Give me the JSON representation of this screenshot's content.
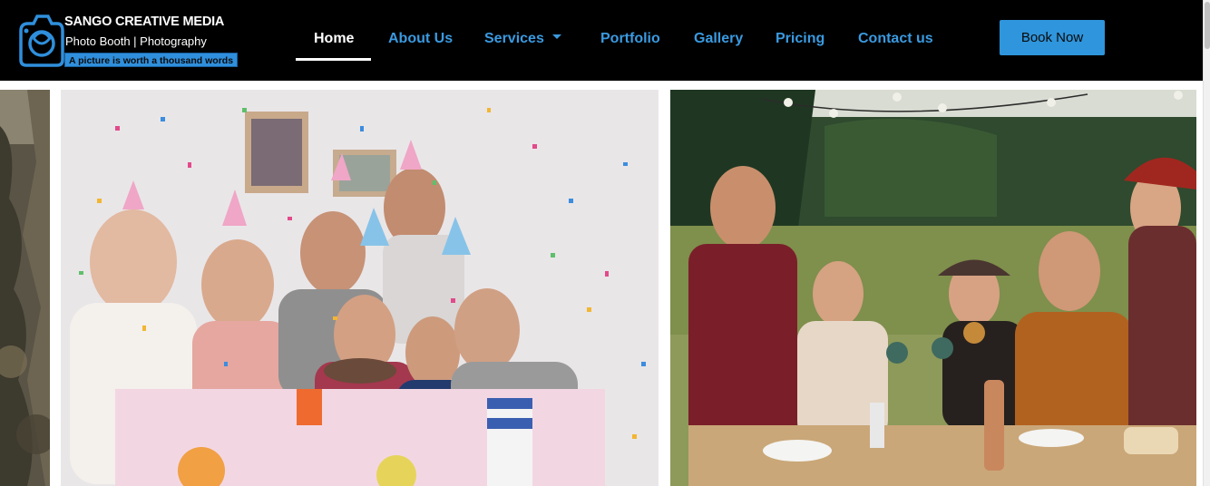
{
  "brand": {
    "title": "SANGO CREATIVE MEDIA",
    "subtitle": "Photo Booth | Photography",
    "tagline": "A picture is worth a thousand words"
  },
  "nav": {
    "items": [
      {
        "label": "Home",
        "active": true
      },
      {
        "label": "About Us",
        "active": false
      },
      {
        "label": "Services",
        "active": false,
        "has_dropdown": true
      },
      {
        "label": "Portfolio",
        "active": false
      },
      {
        "label": "Gallery",
        "active": false
      },
      {
        "label": "Pricing",
        "active": false
      },
      {
        "label": "Contact us",
        "active": false
      }
    ],
    "cta_label": "Book Now"
  },
  "colors": {
    "header_bg": "#000000",
    "accent": "#2f95dc",
    "nav_text": "#3a9ae0",
    "nav_active": "#ffffff"
  },
  "gallery": {
    "images": [
      {
        "icon": "forest-photo"
      },
      {
        "icon": "birthday-party-photo"
      },
      {
        "icon": "outdoor-dinner-photo"
      }
    ]
  }
}
